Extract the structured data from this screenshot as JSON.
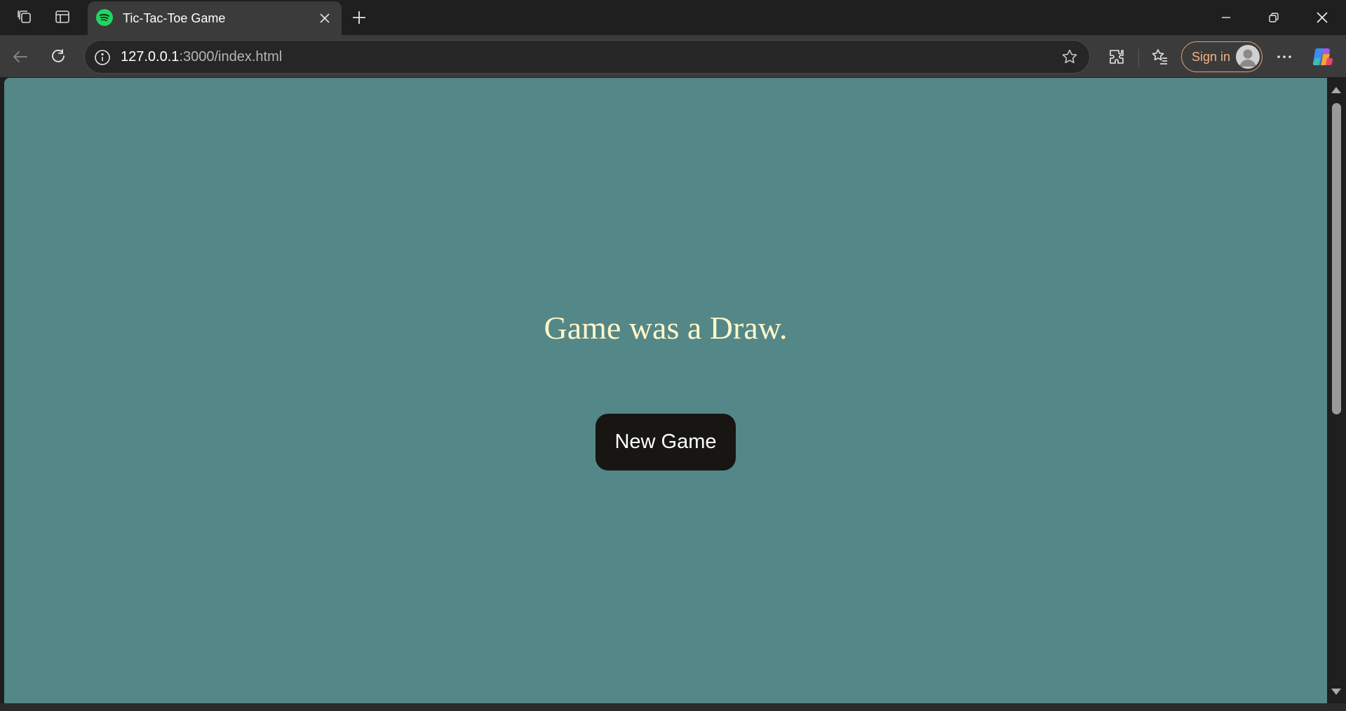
{
  "browser": {
    "tab": {
      "title": "Tic-Tac-Toe Game",
      "favicon": "spotify-icon"
    },
    "address_bar": {
      "host": "127.0.0.1",
      "path": ":3000/index.html"
    },
    "sign_in_label": "Sign in",
    "icons": [
      "workspaces-icon",
      "tab-actions-icon",
      "close-icon",
      "new-tab-icon",
      "minimize-icon",
      "restore-icon",
      "close-window-icon",
      "back-icon",
      "refresh-icon",
      "site-info-icon",
      "favorite-star-icon",
      "extensions-icon",
      "favorites-icon",
      "avatar-icon",
      "more-icon",
      "copilot-icon"
    ]
  },
  "page": {
    "status": "Game was a Draw.",
    "new_game_label": "New Game",
    "colors": {
      "background": "#548787",
      "status_text": "#fff7c9",
      "button_bg": "#171612",
      "button_text": "#ffffff"
    }
  }
}
